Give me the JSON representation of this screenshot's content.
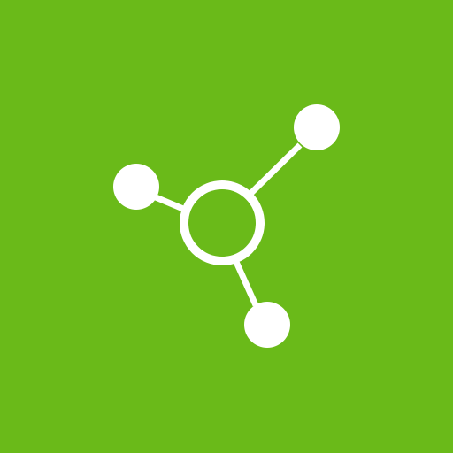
{
  "app_icon": {
    "icon": "share-network-icon",
    "colors": {
      "background": "#6aba19",
      "foreground": "#ffffff"
    }
  }
}
